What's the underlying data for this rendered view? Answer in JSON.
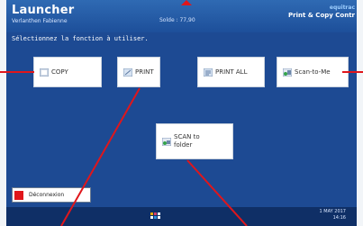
{
  "header": {
    "title": "Launcher",
    "user": "Verlanthen Fabienne",
    "solde": "Solde : 77,90",
    "brand_top": "equitrac",
    "brand_bottom": "Print & Copy Contr"
  },
  "instruction": "Sélectionnez la fonction à utiliser.",
  "buttons": {
    "copy": "COPY",
    "print": "PRINT",
    "print_all": "PRINT ALL",
    "scan_to_me": "Scan-to-Me",
    "scan_folder_line1": "SCAN to",
    "scan_folder_line2": "folder"
  },
  "footer": {
    "logout": "Déconnexion",
    "date": "1 MAY 2017",
    "time": "14:16"
  },
  "colors": {
    "accent": "#e0161b",
    "panel": "#1d4a93"
  },
  "icons": [
    "copy-icon",
    "print-icon",
    "print-all-icon",
    "scan-to-me-icon",
    "scan-to-folder-icon",
    "logout-icon",
    "menu-dots-icon"
  ]
}
